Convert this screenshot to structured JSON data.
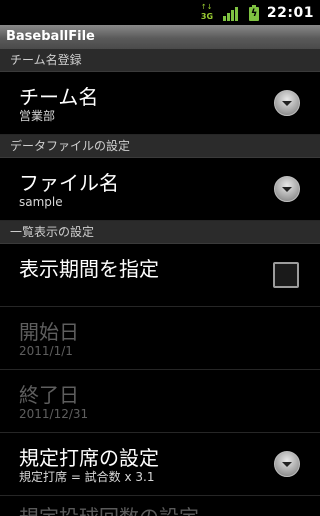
{
  "status": {
    "network_top": "3G",
    "network_bottom": "3G",
    "time": "22:01"
  },
  "app": {
    "title": "BaseballFile"
  },
  "sections": [
    {
      "header": "チーム名登録"
    },
    {
      "header": "データファイルの設定"
    },
    {
      "header": "一覧表示の設定"
    }
  ],
  "team": {
    "title": "チーム名",
    "summary": "営業部"
  },
  "file": {
    "title": "ファイル名",
    "summary": "sample"
  },
  "period": {
    "title": "表示期間を指定",
    "checked": false
  },
  "start": {
    "title": "開始日",
    "summary": "2011/1/1"
  },
  "end": {
    "title": "終了日",
    "summary": "2011/12/31"
  },
  "rule": {
    "title": "規定打席の設定",
    "summary": "規定打席 = 試合数 x 3.1"
  },
  "next": {
    "title": "規定投球回数の設定"
  },
  "icons": [
    "network-3g-icon",
    "signal-icon",
    "battery-charging-icon",
    "spinner-arrow-icon",
    "checkbox"
  ],
  "colors": {
    "signal": "#7fc242",
    "title_bar": "#5a5a5a",
    "background": "#000000"
  }
}
